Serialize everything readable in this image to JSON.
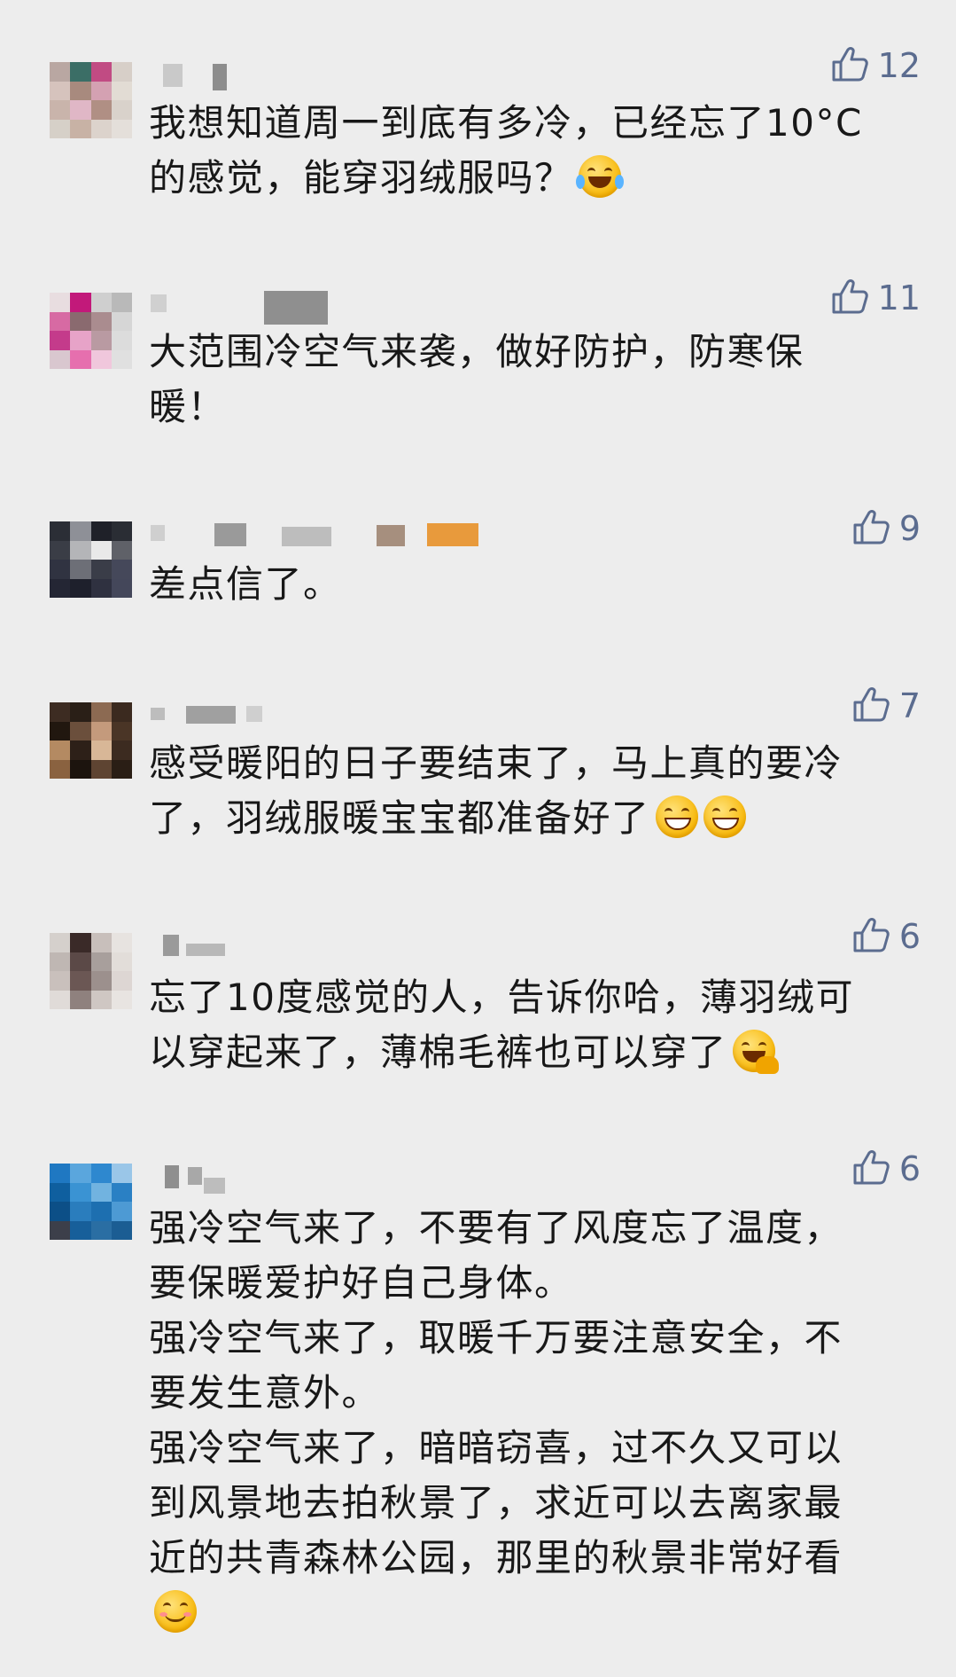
{
  "comments": [
    {
      "likes": "12",
      "text": "我想知道周一到底有多冷，已经忘了10°C\n的感觉，能穿羽绒服吗？",
      "emoji": [
        "tears-of-joy"
      ]
    },
    {
      "likes": "11",
      "text": "大范围冷空气来袭，做好防护，防寒保\n暖！",
      "emoji": []
    },
    {
      "likes": "9",
      "text": "差点信了。",
      "emoji": []
    },
    {
      "likes": "7",
      "text": "感受暖阳的日子要结束了，马上真的要冷\n了，羽绒服暖宝宝都准备好了",
      "emoji": [
        "grin",
        "grin"
      ]
    },
    {
      "likes": "6",
      "text": "忘了10度感觉的人，告诉你哈，薄羽绒可\n以穿起来了，薄棉毛裤也可以穿了",
      "emoji": [
        "facepalm"
      ]
    },
    {
      "likes": "6",
      "text": "强冷空气来了，不要有了风度忘了温度，\n要保暖爱护好自己身体。\n强冷空气来了，取暖千万要注意安全，不\n要发生意外。\n强冷空气来了，暗暗窃喜，过不久又可以\n到风景地去拍秋景了，求近可以去离家最\n近的共青森林公园，那里的秋景非常好看\n",
      "emoji": [
        "smile"
      ]
    }
  ],
  "icons": {
    "like": "thumbs-up-icon"
  },
  "colors": {
    "background": "#ededed",
    "like_accent": "#5b6c8f",
    "text": "#181818"
  }
}
